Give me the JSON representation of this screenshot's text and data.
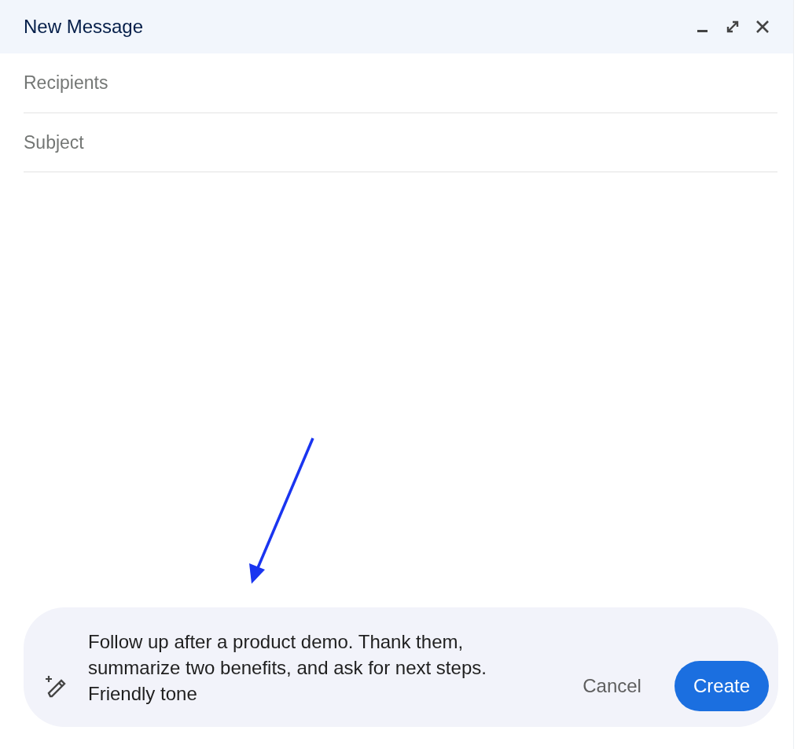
{
  "window": {
    "title": "New Message"
  },
  "fields": [
    {
      "placeholder": "Recipients"
    },
    {
      "placeholder": "Subject"
    }
  ],
  "prompt": {
    "value": "Follow up after a product demo. Thank them, summarize two benefits, and ask for next steps. Friendly tone"
  },
  "buttons": [
    {
      "label": "Cancel",
      "kind": "text"
    },
    {
      "label": "Create",
      "kind": "filled"
    }
  ]
}
